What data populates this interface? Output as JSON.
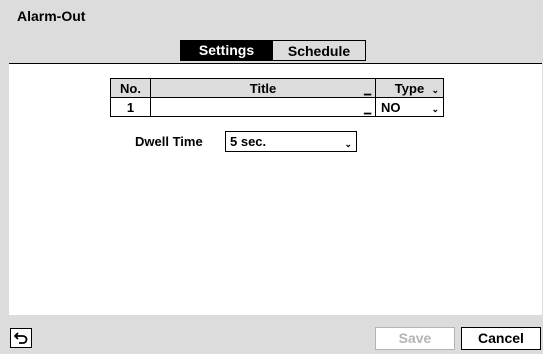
{
  "window": {
    "title": "Alarm-Out"
  },
  "tabs": [
    {
      "label": "Settings",
      "active": true
    },
    {
      "label": "Schedule",
      "active": false
    }
  ],
  "table": {
    "headers": {
      "no": "No.",
      "title": "Title",
      "type": "Type"
    },
    "rows": [
      {
        "no": "1",
        "title": "",
        "type": "NO"
      }
    ]
  },
  "dwell": {
    "label": "Dwell Time",
    "value": "5 sec."
  },
  "footer": {
    "back_icon": "return-arrow-icon",
    "save_label": "Save",
    "save_enabled": false,
    "cancel_label": "Cancel"
  },
  "colors": {
    "panel_bg": "#dcdcdc",
    "content_bg": "#ffffff",
    "active_tab_bg": "#000000",
    "disabled_text": "#b4b4b4"
  }
}
